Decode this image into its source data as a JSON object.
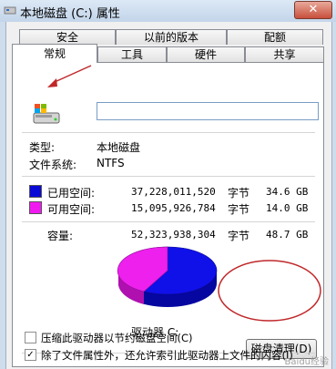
{
  "window": {
    "title": "本地磁盘 (C:) 属性",
    "close_label": "✕"
  },
  "tabs_row1": [
    {
      "label": "安全"
    },
    {
      "label": "以前的版本"
    },
    {
      "label": "配额"
    }
  ],
  "tabs_row2": [
    {
      "label": "常规"
    },
    {
      "label": "工具"
    },
    {
      "label": "硬件"
    },
    {
      "label": "共享"
    }
  ],
  "general": {
    "drive_name_value": "",
    "type_label": "类型:",
    "type_value": "本地磁盘",
    "fs_label": "文件系统:",
    "fs_value": "NTFS",
    "used": {
      "label": "已用空间:",
      "bytes": "37,228,011,520",
      "unit": "字节",
      "size": "34.6 GB",
      "color": "#0a0ad6"
    },
    "free": {
      "label": "可用空间:",
      "bytes": "15,095,926,784",
      "unit": "字节",
      "size": "14.0 GB",
      "color": "#f01af0"
    },
    "capacity": {
      "label": "容量:",
      "bytes": "52,323,938,304",
      "unit": "字节",
      "size": "48.7 GB"
    },
    "drive_label": "驱动器 C:",
    "cleanup_button": "磁盘清理(D)",
    "compress_label": "压缩此驱动器以节约磁盘空间(C)",
    "compress_checked": false,
    "index_label": "除了文件属性外，还允许索引此驱动器上文件的内容(I)",
    "index_checked": true
  },
  "icons": {
    "app": "drive-icon",
    "drive": "hard-drive-icon",
    "close": "close-icon",
    "check": "checkmark-icon"
  },
  "annotations": {
    "red_color": "#c0282a"
  },
  "watermark": "Baidu经验"
}
